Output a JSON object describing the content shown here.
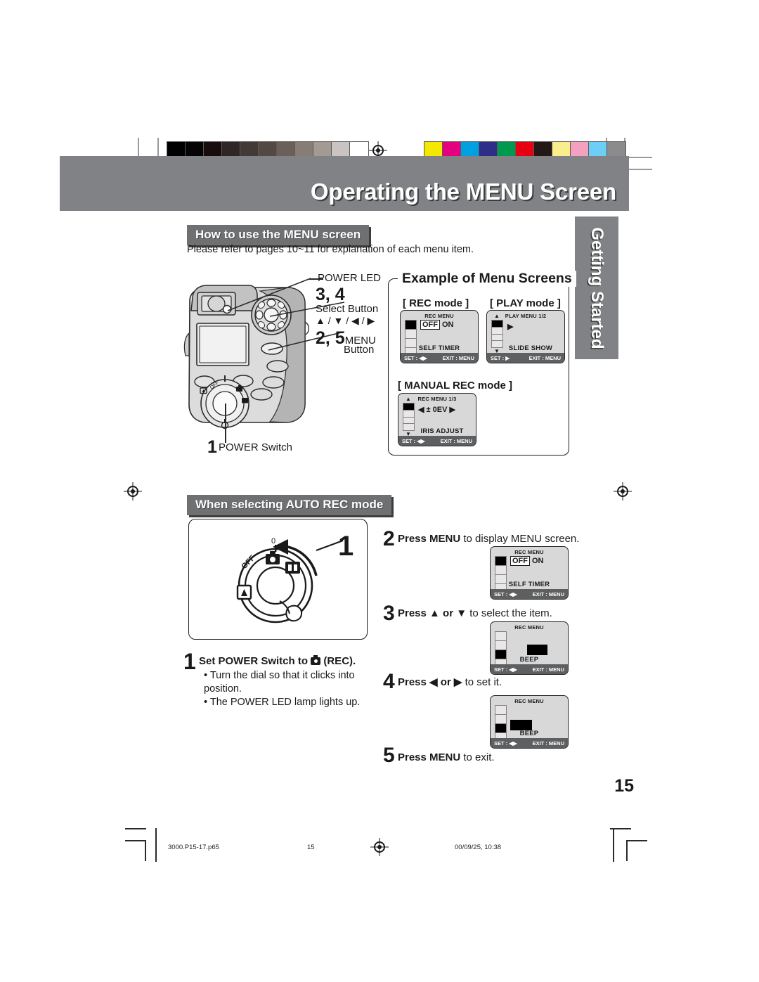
{
  "page": {
    "title": "Operating the MENU Screen",
    "side_tab": "Getting Started",
    "page_number": "15"
  },
  "calibration": {
    "gray_swatches": [
      "#000000",
      "#050303",
      "#160d0c",
      "#2e2725",
      "#423a36",
      "#534843",
      "#6b6059",
      "#877d76",
      "#a39a94",
      "#c9c4c1",
      "#ffffff"
    ],
    "color_swatches": [
      "#f5e800",
      "#e5007e",
      "#00a0e1",
      "#2d2e87",
      "#009a4e",
      "#e60012",
      "#231815",
      "#faee8c",
      "#f4a0bf",
      "#6ecff6",
      "#8b8b8b"
    ]
  },
  "section1": {
    "heading": "How to use the MENU screen",
    "intro": "Please refer to pages 10~11 for explanation of each menu item."
  },
  "camera_callouts": {
    "power_led": "POWER LED",
    "step_34": "3, 4",
    "select_button": "Select Button",
    "select_arrows": "▲ / ▼ / ◀ / ▶",
    "step_25_num": "2, 5",
    "menu_word": "MENU",
    "button_word": "Button",
    "power_switch_num": "1",
    "power_switch_label": "POWER Switch"
  },
  "example_box": {
    "title": "Example of Menu Screens",
    "rec_mode_label": "[ REC mode ]",
    "play_mode_label": "[ PLAY mode ]",
    "manual_rec_label": "[ MANUAL REC mode ]"
  },
  "lcd_screens": {
    "rec_example": {
      "title": "REC MENU",
      "value_highlight": "OFF",
      "value_rest": "ON",
      "item": "SELF TIMER",
      "set": "SET : ◀▶",
      "exit": "EXIT : MENU",
      "up_arrow": "",
      "down_arrow": "",
      "active_cell": 0
    },
    "play_example": {
      "title": "PLAY MENU 1/2",
      "value_highlight": "",
      "value_rest": "▶",
      "item": "SLIDE SHOW",
      "set": "SET :  ▶",
      "exit": "EXIT : MENU",
      "up_arrow": "▲",
      "down_arrow": "▼",
      "active_cell": 0
    },
    "manual_example": {
      "title": "REC MENU 1/3",
      "value_highlight": "",
      "value_rest": "◀ ± 0EV ▶",
      "item": "IRIS ADJUST",
      "set": "SET : ◀▶",
      "exit": "EXIT : MENU",
      "up_arrow": "▲",
      "down_arrow": "▼",
      "active_cell": 0
    },
    "step2": {
      "title": "REC MENU",
      "value_highlight": "OFF",
      "value_rest": "ON",
      "item": "SELF TIMER",
      "set": "SET : ◀▶",
      "exit": "EXIT : MENU",
      "up_arrow": "",
      "down_arrow": "",
      "active_cell": 0
    },
    "step3": {
      "title": "REC MENU",
      "value_highlight": "",
      "value_rest": "",
      "item": "BEEP",
      "set": "SET : ◀▶",
      "exit": "EXIT : MENU",
      "up_arrow": "",
      "down_arrow": "",
      "active_cell": 2
    },
    "step4": {
      "title": "REC MENU",
      "value_highlight": "",
      "value_rest": "",
      "item": "BEEP",
      "set": "SET : ◀▶",
      "exit": "EXIT : MENU",
      "up_arrow": "",
      "down_arrow": "",
      "active_cell": 2
    }
  },
  "section2": {
    "heading": "When selecting AUTO REC mode",
    "dial_step_num": "1",
    "dial_labels": {
      "off": "OFF",
      "zero": "0"
    },
    "step1": {
      "num": "1",
      "text_before": "Set POWER Switch to",
      "text_after": "(REC).",
      "bullet1": "• Turn the dial so that it clicks into",
      "bullet1b": "  position.",
      "bullet2": "• The POWER LED lamp lights up."
    },
    "step2": {
      "num": "2",
      "bold": "Press MENU",
      "rest": " to display MENU screen."
    },
    "step3": {
      "num": "3",
      "bold": "Press ▲ or ▼",
      "rest": " to select the item."
    },
    "step4": {
      "num": "4",
      "bold": "Press ◀ or ▶",
      "rest": " to set it."
    },
    "step5": {
      "num": "5",
      "bold": "Press MENU",
      "rest": " to exit."
    }
  },
  "footer": {
    "filename": "3000.P15-17.p65",
    "page": "15",
    "timestamp": "00/09/25, 10:38"
  }
}
